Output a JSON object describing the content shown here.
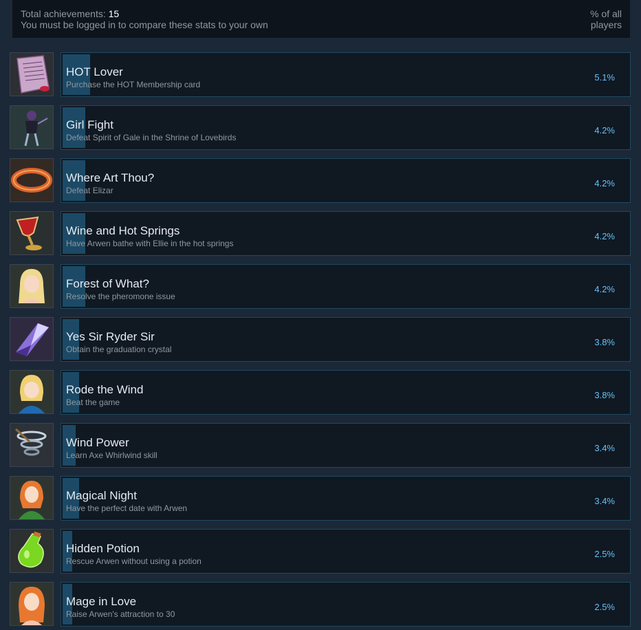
{
  "header": {
    "total_label": "Total achievements:",
    "total_count": "15",
    "login_note": "You must be logged in to compare these stats to your own",
    "pct_header_line1": "% of all",
    "pct_header_line2": "players"
  },
  "achievements": [
    {
      "title": "HOT Lover",
      "desc": "Purchase the HOT Membership card",
      "pct": "5.1%",
      "icon": "love-letter-icon",
      "value": 5.1
    },
    {
      "title": "Girl Fight",
      "desc": "Defeat Spirit of Gale in the Shrine of Lovebirds",
      "pct": "4.2%",
      "icon": "dark-warrior-girl-icon",
      "value": 4.2
    },
    {
      "title": "Where Art Thou?",
      "desc": "Defeat Elizar",
      "pct": "4.2%",
      "icon": "engraved-ring-icon",
      "value": 4.2
    },
    {
      "title": "Wine and Hot Springs",
      "desc": "Have Arwen bathe with Ellie in the hot springs",
      "pct": "4.2%",
      "icon": "wine-goblet-icon",
      "value": 4.2
    },
    {
      "title": "Forest of What?",
      "desc": "Resolve the pheromone issue",
      "pct": "4.2%",
      "icon": "blonde-girl-portrait-icon",
      "value": 4.2
    },
    {
      "title": "Yes Sir Ryder Sir",
      "desc": "Obtain the graduation crystal",
      "pct": "3.8%",
      "icon": "purple-crystal-icon",
      "value": 3.8
    },
    {
      "title": "Rode the Wind",
      "desc": "Beat the game",
      "pct": "3.8%",
      "icon": "blonde-girl-blue-dress-icon",
      "value": 3.8
    },
    {
      "title": "Wind Power",
      "desc": "Learn Axe Whirlwind skill",
      "pct": "3.4%",
      "icon": "whirlwind-icon",
      "value": 3.4
    },
    {
      "title": "Magical Night",
      "desc": "Have the perfect date with Arwen",
      "pct": "3.4%",
      "icon": "orange-hair-girl-green-dress-icon",
      "value": 3.4
    },
    {
      "title": "Hidden Potion",
      "desc": "Rescue Arwen without using a potion",
      "pct": "2.5%",
      "icon": "green-potion-icon",
      "value": 2.5
    },
    {
      "title": "Mage in Love",
      "desc": "Raise Arwen's attraction to 30",
      "pct": "2.5%",
      "icon": "orange-hair-girl-portrait-icon",
      "value": 2.5
    }
  ],
  "colors": {
    "background": "#1b2838",
    "card": "#101822",
    "card_border": "#1f4a5e",
    "progress_fill": "#1c4a66",
    "percent_text": "#66c0f4"
  }
}
